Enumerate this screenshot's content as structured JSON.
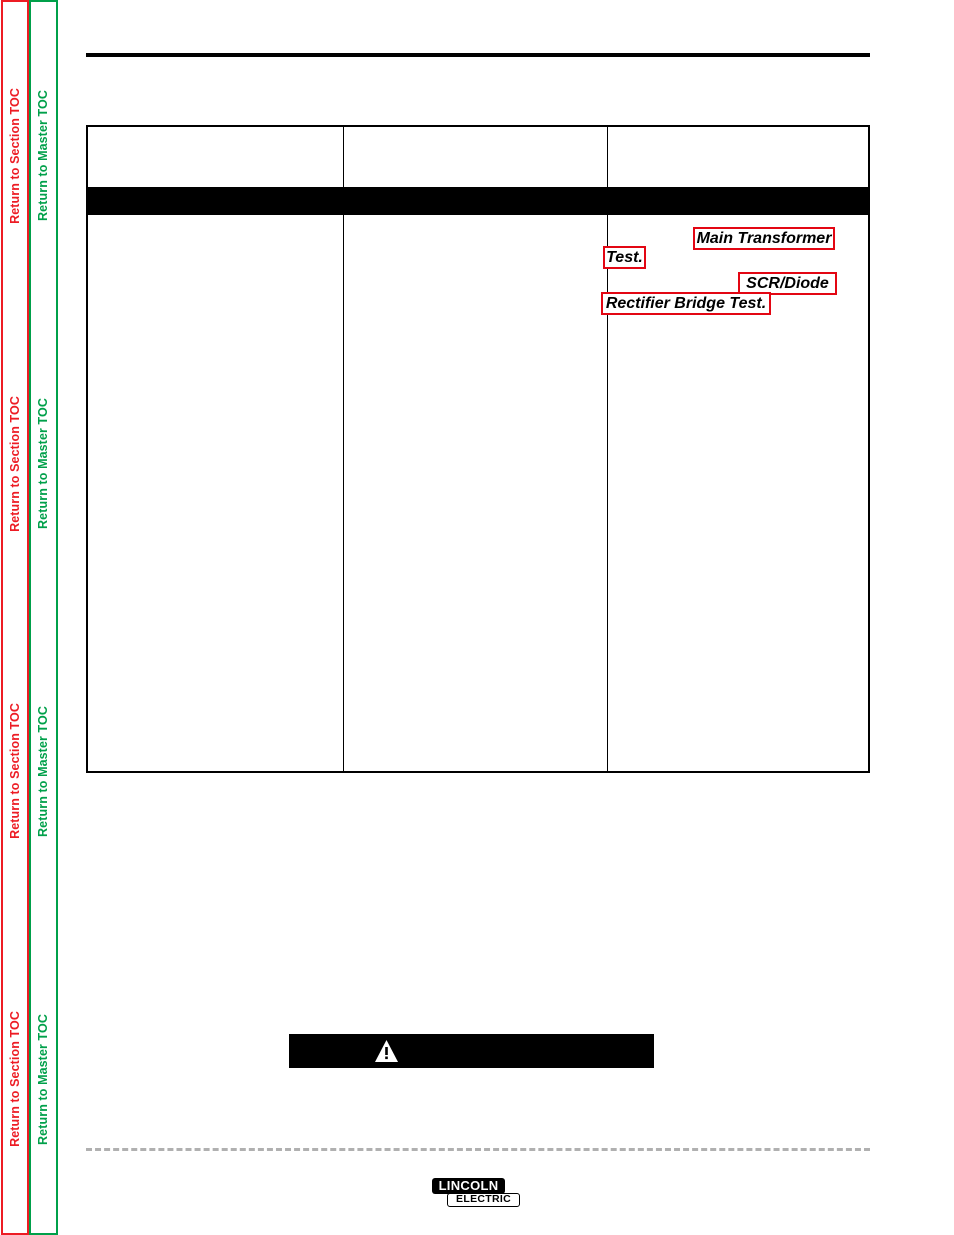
{
  "nav": {
    "section_rail": {
      "label": "Return to Section TOC",
      "color": "#ed1c24",
      "repeats": 4
    },
    "master_rail": {
      "label": "Return to Master TOC",
      "color": "#00a04a",
      "repeats": 4
    }
  },
  "table": {
    "header": {
      "col_a": "",
      "col_b": "",
      "col_c": ""
    },
    "band": {
      "col_a": "",
      "col_b": "",
      "col_c": ""
    },
    "body": {
      "col_a": "",
      "col_b": "",
      "col_c": ""
    }
  },
  "links": [
    {
      "id": "main-transformer",
      "label": "Main Transformer"
    },
    {
      "id": "test",
      "label": "Test."
    },
    {
      "id": "scr-diode",
      "label": "SCR/Diode"
    },
    {
      "id": "rectifier-bridge-test",
      "label": "Rectifier Bridge Test."
    }
  ],
  "warning": {
    "icon": "warning-triangle-icon",
    "text": ""
  },
  "prose": {
    "block_a": "",
    "block_b": ""
  },
  "logo": {
    "line1": "LINCOLN",
    "line2": "ELECTRIC"
  },
  "colors": {
    "section_toc": "#ed1c24",
    "master_toc": "#00a04a",
    "link_box_border": "#e30613",
    "rule": "#000000",
    "dashed_separator": "#b0b0b0"
  }
}
